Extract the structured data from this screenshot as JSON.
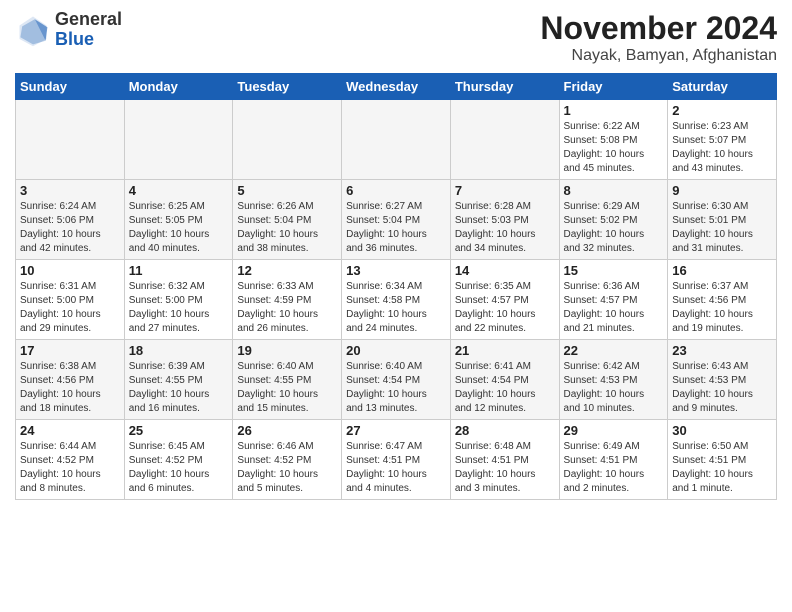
{
  "header": {
    "logo_general": "General",
    "logo_blue": "Blue",
    "title": "November 2024",
    "subtitle": "Nayak, Bamyan, Afghanistan"
  },
  "weekdays": [
    "Sunday",
    "Monday",
    "Tuesday",
    "Wednesday",
    "Thursday",
    "Friday",
    "Saturday"
  ],
  "weeks": [
    [
      {
        "day": "",
        "info": ""
      },
      {
        "day": "",
        "info": ""
      },
      {
        "day": "",
        "info": ""
      },
      {
        "day": "",
        "info": ""
      },
      {
        "day": "",
        "info": ""
      },
      {
        "day": "1",
        "info": "Sunrise: 6:22 AM\nSunset: 5:08 PM\nDaylight: 10 hours\nand 45 minutes."
      },
      {
        "day": "2",
        "info": "Sunrise: 6:23 AM\nSunset: 5:07 PM\nDaylight: 10 hours\nand 43 minutes."
      }
    ],
    [
      {
        "day": "3",
        "info": "Sunrise: 6:24 AM\nSunset: 5:06 PM\nDaylight: 10 hours\nand 42 minutes."
      },
      {
        "day": "4",
        "info": "Sunrise: 6:25 AM\nSunset: 5:05 PM\nDaylight: 10 hours\nand 40 minutes."
      },
      {
        "day": "5",
        "info": "Sunrise: 6:26 AM\nSunset: 5:04 PM\nDaylight: 10 hours\nand 38 minutes."
      },
      {
        "day": "6",
        "info": "Sunrise: 6:27 AM\nSunset: 5:04 PM\nDaylight: 10 hours\nand 36 minutes."
      },
      {
        "day": "7",
        "info": "Sunrise: 6:28 AM\nSunset: 5:03 PM\nDaylight: 10 hours\nand 34 minutes."
      },
      {
        "day": "8",
        "info": "Sunrise: 6:29 AM\nSunset: 5:02 PM\nDaylight: 10 hours\nand 32 minutes."
      },
      {
        "day": "9",
        "info": "Sunrise: 6:30 AM\nSunset: 5:01 PM\nDaylight: 10 hours\nand 31 minutes."
      }
    ],
    [
      {
        "day": "10",
        "info": "Sunrise: 6:31 AM\nSunset: 5:00 PM\nDaylight: 10 hours\nand 29 minutes."
      },
      {
        "day": "11",
        "info": "Sunrise: 6:32 AM\nSunset: 5:00 PM\nDaylight: 10 hours\nand 27 minutes."
      },
      {
        "day": "12",
        "info": "Sunrise: 6:33 AM\nSunset: 4:59 PM\nDaylight: 10 hours\nand 26 minutes."
      },
      {
        "day": "13",
        "info": "Sunrise: 6:34 AM\nSunset: 4:58 PM\nDaylight: 10 hours\nand 24 minutes."
      },
      {
        "day": "14",
        "info": "Sunrise: 6:35 AM\nSunset: 4:57 PM\nDaylight: 10 hours\nand 22 minutes."
      },
      {
        "day": "15",
        "info": "Sunrise: 6:36 AM\nSunset: 4:57 PM\nDaylight: 10 hours\nand 21 minutes."
      },
      {
        "day": "16",
        "info": "Sunrise: 6:37 AM\nSunset: 4:56 PM\nDaylight: 10 hours\nand 19 minutes."
      }
    ],
    [
      {
        "day": "17",
        "info": "Sunrise: 6:38 AM\nSunset: 4:56 PM\nDaylight: 10 hours\nand 18 minutes."
      },
      {
        "day": "18",
        "info": "Sunrise: 6:39 AM\nSunset: 4:55 PM\nDaylight: 10 hours\nand 16 minutes."
      },
      {
        "day": "19",
        "info": "Sunrise: 6:40 AM\nSunset: 4:55 PM\nDaylight: 10 hours\nand 15 minutes."
      },
      {
        "day": "20",
        "info": "Sunrise: 6:40 AM\nSunset: 4:54 PM\nDaylight: 10 hours\nand 13 minutes."
      },
      {
        "day": "21",
        "info": "Sunrise: 6:41 AM\nSunset: 4:54 PM\nDaylight: 10 hours\nand 12 minutes."
      },
      {
        "day": "22",
        "info": "Sunrise: 6:42 AM\nSunset: 4:53 PM\nDaylight: 10 hours\nand 10 minutes."
      },
      {
        "day": "23",
        "info": "Sunrise: 6:43 AM\nSunset: 4:53 PM\nDaylight: 10 hours\nand 9 minutes."
      }
    ],
    [
      {
        "day": "24",
        "info": "Sunrise: 6:44 AM\nSunset: 4:52 PM\nDaylight: 10 hours\nand 8 minutes."
      },
      {
        "day": "25",
        "info": "Sunrise: 6:45 AM\nSunset: 4:52 PM\nDaylight: 10 hours\nand 6 minutes."
      },
      {
        "day": "26",
        "info": "Sunrise: 6:46 AM\nSunset: 4:52 PM\nDaylight: 10 hours\nand 5 minutes."
      },
      {
        "day": "27",
        "info": "Sunrise: 6:47 AM\nSunset: 4:51 PM\nDaylight: 10 hours\nand 4 minutes."
      },
      {
        "day": "28",
        "info": "Sunrise: 6:48 AM\nSunset: 4:51 PM\nDaylight: 10 hours\nand 3 minutes."
      },
      {
        "day": "29",
        "info": "Sunrise: 6:49 AM\nSunset: 4:51 PM\nDaylight: 10 hours\nand 2 minutes."
      },
      {
        "day": "30",
        "info": "Sunrise: 6:50 AM\nSunset: 4:51 PM\nDaylight: 10 hours\nand 1 minute."
      }
    ]
  ]
}
